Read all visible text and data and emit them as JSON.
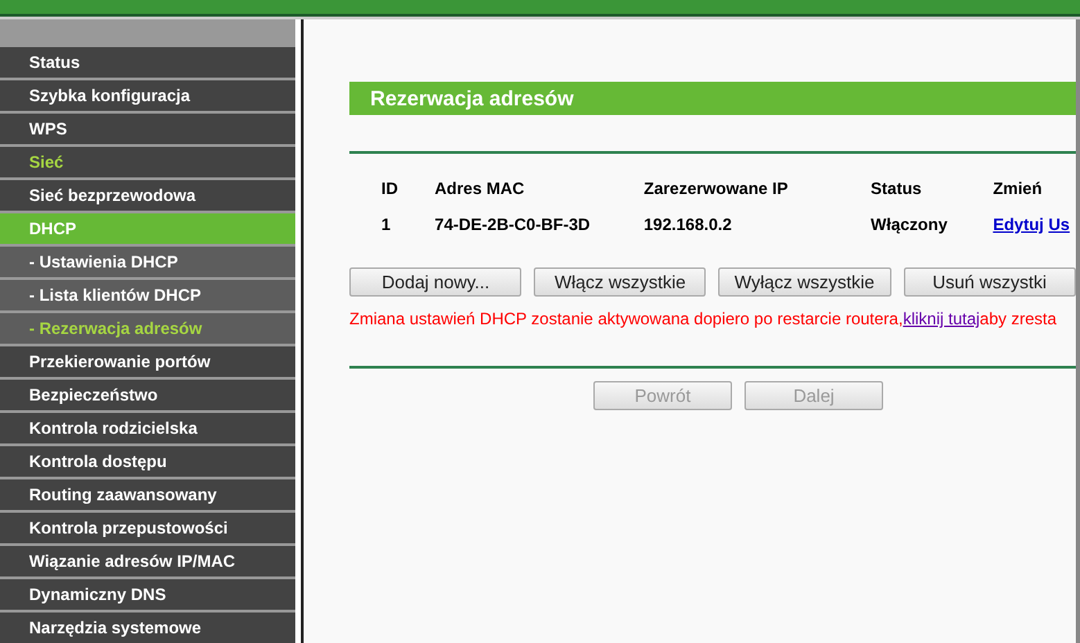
{
  "sidebar": {
    "items": [
      {
        "label": "Status",
        "kind": "main",
        "selected": false,
        "highlighted": false
      },
      {
        "label": "Szybka konfiguracja",
        "kind": "main",
        "selected": false,
        "highlighted": false
      },
      {
        "label": "WPS",
        "kind": "main",
        "selected": false,
        "highlighted": false
      },
      {
        "label": "Sieć",
        "kind": "main",
        "selected": false,
        "highlighted": true
      },
      {
        "label": "Sieć bezprzewodowa",
        "kind": "main",
        "selected": false,
        "highlighted": false
      },
      {
        "label": "DHCP",
        "kind": "main",
        "selected": true,
        "highlighted": false
      },
      {
        "label": "- Ustawienia DHCP",
        "kind": "sub",
        "selected": false,
        "highlighted": false
      },
      {
        "label": "- Lista klientów DHCP",
        "kind": "sub",
        "selected": false,
        "highlighted": false
      },
      {
        "label": "- Rezerwacja adresów",
        "kind": "sub",
        "selected": true,
        "highlighted": false
      },
      {
        "label": "Przekierowanie portów",
        "kind": "main",
        "selected": false,
        "highlighted": false
      },
      {
        "label": "Bezpieczeństwo",
        "kind": "main",
        "selected": false,
        "highlighted": false
      },
      {
        "label": "Kontrola rodzicielska",
        "kind": "main",
        "selected": false,
        "highlighted": false
      },
      {
        "label": "Kontrola dostępu",
        "kind": "main",
        "selected": false,
        "highlighted": false
      },
      {
        "label": "Routing zaawansowany",
        "kind": "main",
        "selected": false,
        "highlighted": false
      },
      {
        "label": "Kontrola przepustowości",
        "kind": "main",
        "selected": false,
        "highlighted": false
      },
      {
        "label": "Wiązanie adresów IP/MAC",
        "kind": "main",
        "selected": false,
        "highlighted": false
      },
      {
        "label": "Dynamiczny DNS",
        "kind": "main",
        "selected": false,
        "highlighted": false
      },
      {
        "label": "Narzędzia systemowe",
        "kind": "main",
        "selected": false,
        "highlighted": false
      }
    ]
  },
  "panel": {
    "title": "Rezerwacja adresów",
    "table": {
      "columns": [
        "ID",
        "Adres MAC",
        "Zarezerwowane IP",
        "Status",
        "Zmień"
      ],
      "rows": [
        {
          "cells": [
            "1",
            "74-DE-2B-C0-BF-3D",
            "192.168.0.2",
            "Włączony"
          ],
          "links": [
            "Edytuj",
            "Us"
          ]
        }
      ]
    },
    "buttons": [
      {
        "label": "Dodaj nowy...",
        "disabled": false
      },
      {
        "label": "Włącz wszystkie",
        "disabled": false
      },
      {
        "label": "Wyłącz wszystkie",
        "disabled": false
      },
      {
        "label": "Usuń wszystki",
        "disabled": false
      }
    ],
    "message": {
      "before": "Zmiana ustawień DHCP zostanie aktywowana dopiero po restarcie routera,",
      "link": "kliknij tutaj",
      "after": "aby zresta"
    },
    "nav_buttons": [
      {
        "label": "Powrót",
        "disabled": true
      },
      {
        "label": "Dalej",
        "disabled": true
      }
    ]
  }
}
